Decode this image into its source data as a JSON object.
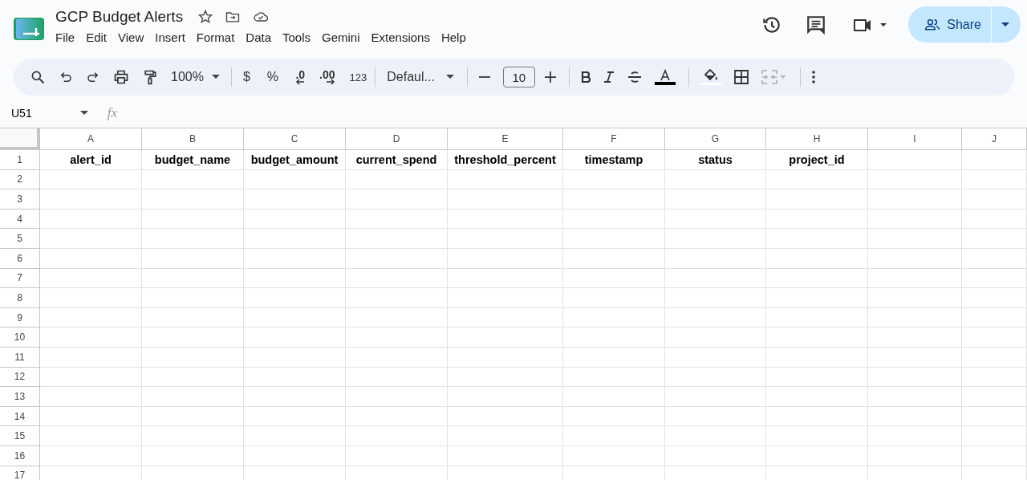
{
  "document": {
    "title": "GCP Budget Alerts"
  },
  "menu": [
    "File",
    "Edit",
    "View",
    "Insert",
    "Format",
    "Data",
    "Tools",
    "Gemini",
    "Extensions",
    "Help"
  ],
  "share_button": {
    "label": "Share"
  },
  "toolbar": {
    "zoom": "100%",
    "currency": "$",
    "percent": "%",
    "decrease_decimals": ".0",
    "increase_decimals": ".00",
    "number_format": "123",
    "font": "Defaul...",
    "font_size": "10"
  },
  "name_box": "U51",
  "formula_label": "fx",
  "sheet": {
    "columns": [
      "A",
      "B",
      "C",
      "D",
      "E",
      "F",
      "G",
      "H",
      "I",
      "J"
    ],
    "rows": [
      {
        "number": "1",
        "cells": [
          "alert_id",
          "budget_name",
          "budget_amount",
          "current_spend",
          "threshold_percent",
          "timestamp",
          "status",
          "project_id"
        ]
      },
      {
        "number": "2",
        "cells": []
      },
      {
        "number": "3",
        "cells": []
      },
      {
        "number": "4",
        "cells": []
      },
      {
        "number": "5",
        "cells": []
      },
      {
        "number": "6",
        "cells": []
      },
      {
        "number": "7",
        "cells": []
      },
      {
        "number": "8",
        "cells": []
      },
      {
        "number": "9",
        "cells": []
      },
      {
        "number": "10",
        "cells": []
      },
      {
        "number": "11",
        "cells": []
      },
      {
        "number": "12",
        "cells": []
      },
      {
        "number": "13",
        "cells": []
      },
      {
        "number": "14",
        "cells": []
      },
      {
        "number": "15",
        "cells": []
      },
      {
        "number": "16",
        "cells": []
      },
      {
        "number": "17",
        "cells": []
      }
    ]
  }
}
